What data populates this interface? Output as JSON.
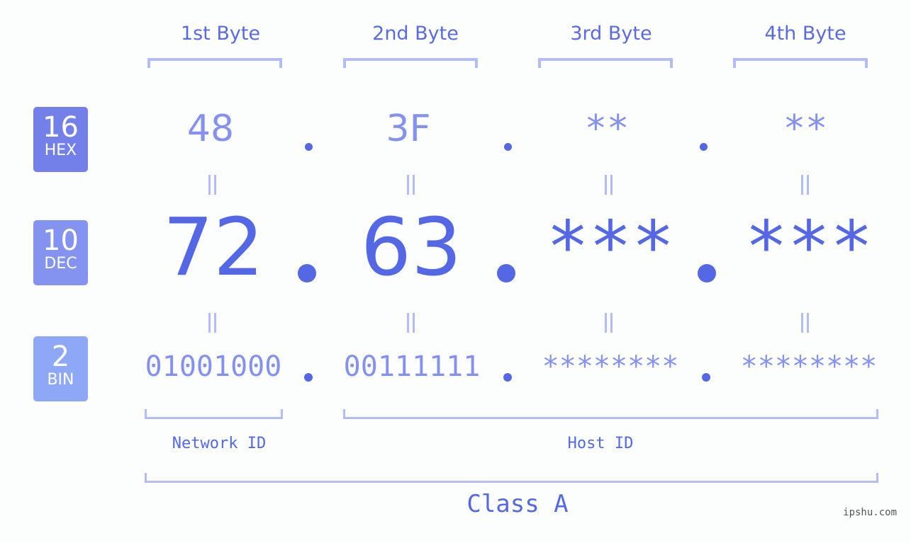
{
  "byte_headers": [
    "1st Byte",
    "2nd Byte",
    "3rd Byte",
    "4th Byte"
  ],
  "rows": {
    "hex": {
      "base": "16",
      "label": "HEX",
      "color": "#7480ea",
      "values": [
        "48",
        "3F",
        "**",
        "**"
      ]
    },
    "dec": {
      "base": "10",
      "label": "DEC",
      "color": "#8493f0",
      "values": [
        "72",
        "63",
        "***",
        "***"
      ]
    },
    "bin": {
      "base": "2",
      "label": "BIN",
      "color": "#8fa7f7",
      "values": [
        "01001000",
        "00111111",
        "********",
        "********"
      ]
    }
  },
  "separator": ".",
  "network_id_label": "Network ID",
  "host_id_label": "Host ID",
  "class_label": "Class A",
  "watermark": "ipshu.com",
  "colors": {
    "accent": "#5468e6",
    "light_value": "#8591ef",
    "bracket": "#b3bcf5"
  }
}
